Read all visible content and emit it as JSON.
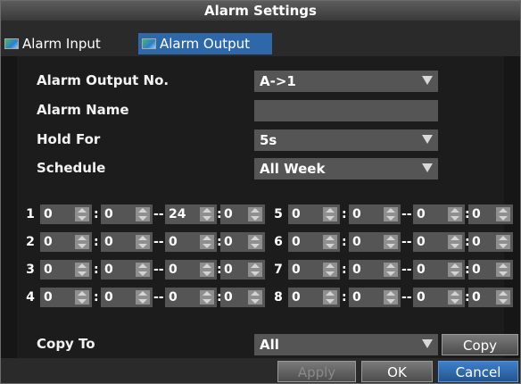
{
  "window": {
    "title": "Alarm Settings"
  },
  "tabs": [
    {
      "label": "Alarm Input",
      "active": false
    },
    {
      "label": "Alarm Output",
      "active": true
    }
  ],
  "form": {
    "alarm_output_no": {
      "label": "Alarm Output No.",
      "value": "A->1"
    },
    "alarm_name": {
      "label": "Alarm Name",
      "value": ""
    },
    "hold_for": {
      "label": "Hold For",
      "value": "5s"
    },
    "schedule": {
      "label": "Schedule",
      "value": "All Week"
    }
  },
  "schedule_rows": [
    {
      "index": "1",
      "start_h": "0",
      "start_m": "0",
      "end_h": "24",
      "end_m": "0"
    },
    {
      "index": "2",
      "start_h": "0",
      "start_m": "0",
      "end_h": "0",
      "end_m": "0"
    },
    {
      "index": "3",
      "start_h": "0",
      "start_m": "0",
      "end_h": "0",
      "end_m": "0"
    },
    {
      "index": "4",
      "start_h": "0",
      "start_m": "0",
      "end_h": "0",
      "end_m": "0"
    },
    {
      "index": "5",
      "start_h": "0",
      "start_m": "0",
      "end_h": "0",
      "end_m": "0"
    },
    {
      "index": "6",
      "start_h": "0",
      "start_m": "0",
      "end_h": "0",
      "end_m": "0"
    },
    {
      "index": "7",
      "start_h": "0",
      "start_m": "0",
      "end_h": "0",
      "end_m": "0"
    },
    {
      "index": "8",
      "start_h": "0",
      "start_m": "0",
      "end_h": "0",
      "end_m": "0"
    }
  ],
  "time_sep": ":",
  "range_sep": "--",
  "copy_to": {
    "label": "Copy To",
    "value": "All",
    "button": "Copy"
  },
  "buttons": {
    "apply": "Apply",
    "ok": "OK",
    "cancel": "Cancel"
  },
  "colors": {
    "accent": "#2f68a8",
    "field_bg": "#555555",
    "panel_bg": "#1c1c1c"
  },
  "icons": {
    "tab_icon": "image-icon",
    "dropdown": "chevron-down-icon",
    "spinner": "spinner-icon"
  }
}
